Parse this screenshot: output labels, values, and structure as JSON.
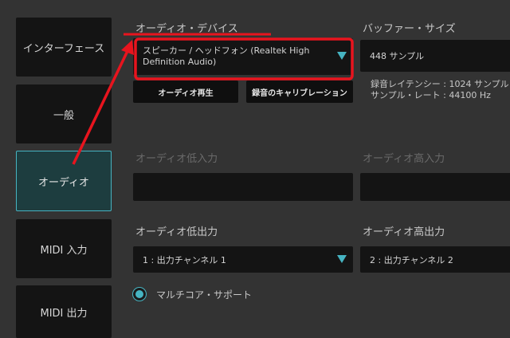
{
  "sidebar": {
    "items": [
      {
        "label": "インターフェース"
      },
      {
        "label": "一般"
      },
      {
        "label": "オーディオ"
      },
      {
        "label": "MIDI 入力"
      },
      {
        "label": "MIDI 出力"
      }
    ]
  },
  "audio_device": {
    "label": "オーディオ・デバイス",
    "value_line1": "スピーカー / ヘッドフォン (Realtek High",
    "value_line2": "Definition Audio)"
  },
  "buffer": {
    "label": "バッファー・サイズ",
    "value": "448 サンプル"
  },
  "buttons": {
    "audio_play": "オーディオ再生",
    "rec_calibration": "録音のキャリブレーション"
  },
  "latency": {
    "line1": "録音レイテンシー : 1024 サンプル",
    "line2": "サンプル・レート : 44100 Hz"
  },
  "audio_low_in": {
    "label": "オーディオ低入力"
  },
  "audio_high_in": {
    "label": "オーディオ高入力"
  },
  "audio_low_out": {
    "label": "オーディオ低出力",
    "value": "1 : 出力チャンネル 1"
  },
  "audio_high_out": {
    "label": "オーディオ高出力",
    "value": "2 : 出力チャンネル 2"
  },
  "multicore": {
    "label": "マルチコア・サポート"
  },
  "colors": {
    "accent": "#46b4c2",
    "annotation": "#e8141e",
    "background": "#333333",
    "field": "#141414"
  },
  "icons": {
    "dropdown": "triangle-down-icon",
    "radio": "radio-on-icon",
    "annotation": "red-arrow-annotation"
  }
}
